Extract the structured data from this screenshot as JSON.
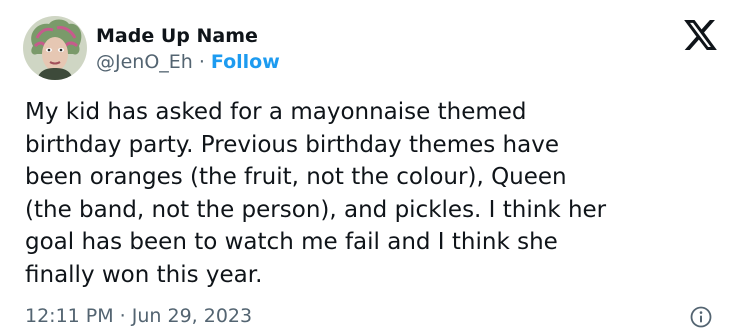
{
  "author": {
    "name": "Made Up Name",
    "handle": "@JenO_Eh",
    "separator": "·",
    "follow_label": "Follow",
    "avatar_icon": "avatar-image"
  },
  "brand": {
    "logo_icon": "x-logo-icon"
  },
  "tweet": {
    "text": "My kid has asked for a mayonnaise themed\nbirthday party. Previous birthday themes have\nbeen oranges (the fruit, not the colour), Queen\n(the band, not the person), and pickles. I think her\ngoal has been to watch me fail and I think she\nfinally won this year.",
    "timestamp": "12:11 PM · Jun 29, 2023",
    "info_icon": "info-icon"
  },
  "colors": {
    "text_primary": "#0f1419",
    "text_secondary": "#536471",
    "accent": "#1d9bf0"
  }
}
